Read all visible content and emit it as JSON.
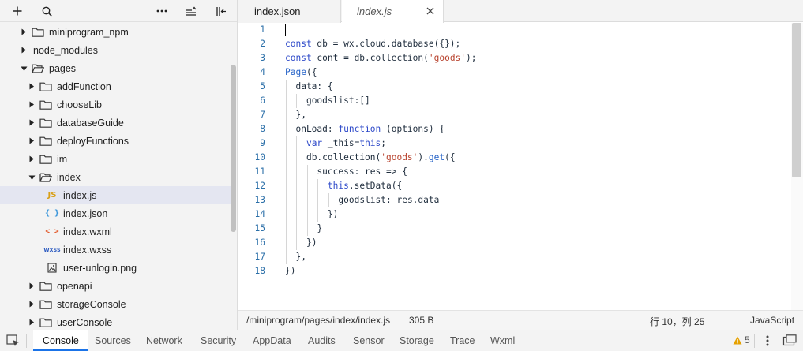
{
  "explorer": {
    "items": [
      {
        "label": "miniprogram_npm",
        "type": "folder",
        "depth": 1,
        "expanded": false,
        "icon": "folder-icon"
      },
      {
        "label": "node_modules",
        "type": "chevron-only",
        "depth": 1,
        "expanded": false,
        "icon": "none"
      },
      {
        "label": "pages",
        "type": "folder",
        "depth": 1,
        "expanded": true,
        "icon": "folder-open-icon"
      },
      {
        "label": "addFunction",
        "type": "folder",
        "depth": 2,
        "expanded": false,
        "icon": "folder-icon"
      },
      {
        "label": "chooseLib",
        "type": "folder",
        "depth": 2,
        "expanded": false,
        "icon": "folder-icon"
      },
      {
        "label": "databaseGuide",
        "type": "folder",
        "depth": 2,
        "expanded": false,
        "icon": "folder-icon"
      },
      {
        "label": "deployFunctions",
        "type": "folder",
        "depth": 2,
        "expanded": false,
        "icon": "folder-icon"
      },
      {
        "label": "im",
        "type": "folder",
        "depth": 2,
        "expanded": false,
        "icon": "folder-icon"
      },
      {
        "label": "index",
        "type": "folder",
        "depth": 2,
        "expanded": true,
        "icon": "folder-open-icon"
      },
      {
        "label": "index.js",
        "type": "file",
        "depth": 3,
        "icon": "js-file-icon",
        "badge": "JS",
        "selected": true
      },
      {
        "label": "index.json",
        "type": "file",
        "depth": 3,
        "icon": "json-file-icon",
        "badge": "{ }"
      },
      {
        "label": "index.wxml",
        "type": "file",
        "depth": 3,
        "icon": "wxml-file-icon",
        "badge": "< >"
      },
      {
        "label": "index.wxss",
        "type": "file",
        "depth": 3,
        "icon": "wxss-file-icon",
        "badge": "WXSS"
      },
      {
        "label": "user-unlogin.png",
        "type": "file",
        "depth": 3,
        "icon": "image-file-icon",
        "badge": ""
      },
      {
        "label": "openapi",
        "type": "folder",
        "depth": 2,
        "expanded": false,
        "icon": "folder-icon"
      },
      {
        "label": "storageConsole",
        "type": "folder",
        "depth": 2,
        "expanded": false,
        "icon": "folder-icon"
      },
      {
        "label": "userConsole",
        "type": "folder",
        "depth": 2,
        "expanded": false,
        "icon": "folder-icon"
      }
    ]
  },
  "editor": {
    "tabs": [
      {
        "label": "index.json",
        "active": false
      },
      {
        "label": "index.js",
        "active": true
      }
    ],
    "lines": [
      {
        "n": "1",
        "indent": 0,
        "tokens": [
          {
            "t": ""
          }
        ]
      },
      {
        "n": "2",
        "indent": 0,
        "tokens": [
          {
            "t": "const ",
            "c": "kw"
          },
          {
            "t": "db = wx.cloud.database({});"
          }
        ]
      },
      {
        "n": "3",
        "indent": 0,
        "tokens": [
          {
            "t": "const ",
            "c": "kw"
          },
          {
            "t": "cont = db.collection("
          },
          {
            "t": "'goods'",
            "c": "str"
          },
          {
            "t": ");"
          }
        ]
      },
      {
        "n": "4",
        "indent": 0,
        "tokens": [
          {
            "t": "Page",
            "c": "fn"
          },
          {
            "t": "({"
          }
        ]
      },
      {
        "n": "5",
        "indent": 1,
        "tokens": [
          {
            "t": "data: {"
          }
        ]
      },
      {
        "n": "6",
        "indent": 2,
        "tokens": [
          {
            "t": "goodslist:[]"
          }
        ]
      },
      {
        "n": "7",
        "indent": 1,
        "tokens": [
          {
            "t": "},"
          }
        ]
      },
      {
        "n": "8",
        "indent": 1,
        "tokens": [
          {
            "t": "onLoad: "
          },
          {
            "t": "function",
            "c": "kw"
          },
          {
            "t": " (options) {"
          }
        ]
      },
      {
        "n": "9",
        "indent": 2,
        "tokens": [
          {
            "t": "var ",
            "c": "kw"
          },
          {
            "t": "_this="
          },
          {
            "t": "this",
            "c": "kw"
          },
          {
            "t": ";"
          }
        ]
      },
      {
        "n": "10",
        "indent": 2,
        "tokens": [
          {
            "t": "db.collection("
          },
          {
            "t": "'goods'",
            "c": "str"
          },
          {
            "t": ")."
          },
          {
            "t": "get",
            "c": "fn"
          },
          {
            "t": "({"
          }
        ]
      },
      {
        "n": "11",
        "indent": 3,
        "tokens": [
          {
            "t": "success: res => {"
          }
        ]
      },
      {
        "n": "12",
        "indent": 4,
        "tokens": [
          {
            "t": "this",
            "c": "kw"
          },
          {
            "t": ".setData({"
          }
        ]
      },
      {
        "n": "13",
        "indent": 5,
        "tokens": [
          {
            "t": "goodslist: res.data"
          }
        ]
      },
      {
        "n": "14",
        "indent": 4,
        "tokens": [
          {
            "t": "})"
          }
        ]
      },
      {
        "n": "15",
        "indent": 3,
        "tokens": [
          {
            "t": "}"
          }
        ]
      },
      {
        "n": "16",
        "indent": 2,
        "tokens": [
          {
            "t": "})"
          }
        ]
      },
      {
        "n": "17",
        "indent": 1,
        "tokens": [
          {
            "t": "},"
          }
        ]
      },
      {
        "n": "18",
        "indent": 0,
        "tokens": [
          {
            "t": "})"
          }
        ]
      }
    ],
    "status": {
      "path": "/miniprogram/pages/index/index.js",
      "size": "305 B",
      "position": "行 10，列 25",
      "language": "JavaScript"
    }
  },
  "devtools": {
    "tabs": [
      {
        "label": "Console",
        "active": true
      },
      {
        "label": "Sources",
        "active": false
      },
      {
        "label": "Network",
        "active": false
      },
      {
        "label": "Security",
        "active": false
      },
      {
        "label": "AppData",
        "active": false
      },
      {
        "label": "Audits",
        "active": false
      },
      {
        "label": "Sensor",
        "active": false
      },
      {
        "label": "Storage",
        "active": false
      },
      {
        "label": "Trace",
        "active": false
      },
      {
        "label": "Wxml",
        "active": false
      }
    ],
    "warnings": "5"
  },
  "colors": {
    "keyword": "#2d49c9",
    "string": "#b8432e",
    "line_number": "#2b6fa8",
    "active_tab_underline": "#1a73e8",
    "warning": "#e6a100"
  }
}
